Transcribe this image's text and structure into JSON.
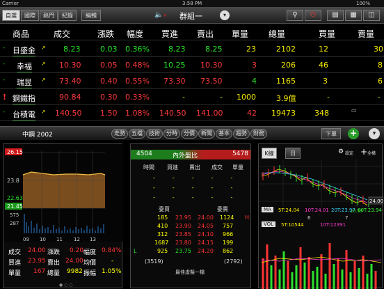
{
  "status": {
    "carrier": "Carrier",
    "time": "3:58 PM",
    "battery": "100%"
  },
  "toolbar": {
    "tabs": [
      "自選",
      "國際",
      "熱門",
      "紀錄"
    ],
    "edit": "編輯",
    "group": "群組一"
  },
  "columns": [
    "商品",
    "成交",
    "漲跌",
    "幅度",
    "買進",
    "賣出",
    "單量",
    "總量",
    "買量",
    "賣量"
  ],
  "rows": [
    {
      "name": "日盛金",
      "price": "8.23",
      "chg": "0.03",
      "pct": "0.36%",
      "bid": "8.23",
      "ask": "8.25",
      "vol": "23",
      "total": "2102",
      "bidq": "12",
      "askq": "30"
    },
    {
      "name": "幸福",
      "price": "10.30",
      "chg": "0.05",
      "pct": "0.48%",
      "bid": "10.25",
      "ask": "10.30",
      "vol": "3",
      "total": "206",
      "bidq": "46",
      "askq": "8"
    },
    {
      "name": "瑞昱",
      "price": "73.40",
      "chg": "0.40",
      "pct": "0.55%",
      "bid": "73.30",
      "ask": "73.50",
      "vol": "4",
      "total": "1165",
      "bidq": "3",
      "askq": "6"
    },
    {
      "name": "鋼鐵指",
      "price": "90.84",
      "chg": "0.30",
      "pct": "0.33%",
      "bid": "-",
      "ask": "-",
      "vol": "1000",
      "total": "3.9億",
      "bidq": "-",
      "askq": "-"
    },
    {
      "name": "台積電",
      "price": "140.50",
      "chg": "1.50",
      "pct": "1.08%",
      "bid": "140.50",
      "ask": "141.00",
      "vol": "42",
      "total": "19473",
      "bidq": "348",
      "askq": "1"
    }
  ],
  "subbar": {
    "title": "中鋼 2002",
    "tabs": [
      "走勢",
      "五檔",
      "技術",
      "分時",
      "分價",
      "新聞",
      "基本",
      "趨勢",
      "財務"
    ],
    "order": "下單"
  },
  "chart1": {
    "hi": "26.15",
    "mid": "23.8",
    "lo1": "22.63",
    "lo2": "21.45",
    "v1": "575",
    "v2": "287",
    "t": [
      "09",
      "10",
      "11",
      "12",
      "13"
    ]
  },
  "quote": {
    "l1": "成交",
    "v1": "24.00",
    "l2": "漲跌",
    "v2": "0.20",
    "l3": "幅度",
    "v3": "0.84%",
    "l4": "買進",
    "v4": "23.95",
    "l5": "賣出",
    "v5": "24.00",
    "l6": "均價",
    "v6": "-",
    "l7": "單量",
    "v7": "167",
    "l8": "總量",
    "v8": "9982",
    "l9": "振幅",
    "v9": "1.05%"
  },
  "book": {
    "buy": "4504",
    "label": "內外盤比",
    "sell": "5478",
    "cols": [
      "時間",
      "買進",
      "賣出",
      "成交",
      "單量"
    ],
    "hcols": [
      "委買",
      "委賣"
    ],
    "rows": [
      [
        "185",
        "23.95",
        "24.00",
        "1124"
      ],
      [
        "410",
        "23.90",
        "24.05",
        "757"
      ],
      [
        "312",
        "23.85",
        "24.10",
        "966"
      ],
      [
        "1687",
        "23.80",
        "24.15",
        "199"
      ],
      [
        "925",
        "23.75",
        "24.20",
        "862"
      ]
    ],
    "tbuy": "(3519)",
    "tsell": "(2792)",
    "best": "最佳虛擬一檔"
  },
  "kchart": {
    "tab": "K線",
    "period": "日",
    "set": "設定",
    "full": "全橫",
    "ma": "MA",
    "ma1": "5T:24.04",
    "ma2": "10T:24.01",
    "ma3": "20T:23.97",
    "ma4": "60T:23.94",
    "vol": "VOL",
    "vol1": "5T:10544",
    "vol2": "10T:12391",
    "p1": "24.00",
    "p2": "23.55",
    "xt": [
      "6",
      "7"
    ]
  }
}
